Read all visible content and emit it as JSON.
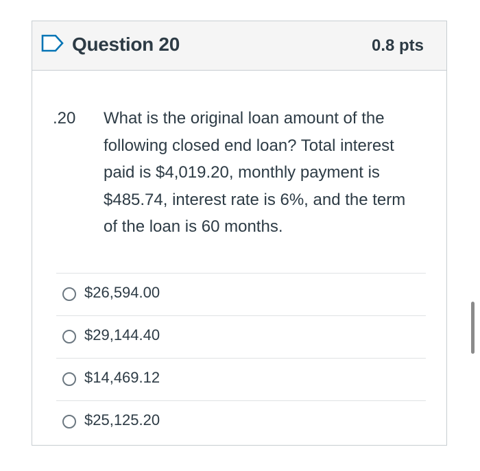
{
  "question": {
    "title": "Question 20",
    "points": "0.8 pts",
    "number": "20.",
    "text": "What is the original loan amount of the following closed end loan? Total interest paid is $4,019.20, monthly payment is $485.74, interest rate is 6%, and the term of the loan is 60 months."
  },
  "answers": [
    {
      "label": "$26,594.00"
    },
    {
      "label": "$29,144.40"
    },
    {
      "label": "$14,469.12"
    },
    {
      "label": "$25,125.20"
    }
  ],
  "icons": {
    "flag": "flag-question-icon",
    "radio": "radio-button-icon"
  },
  "colors": {
    "text": "#2d3b45",
    "header_bg": "#f5f5f5",
    "border": "#c7cdd1",
    "flag": "#0374b5"
  }
}
